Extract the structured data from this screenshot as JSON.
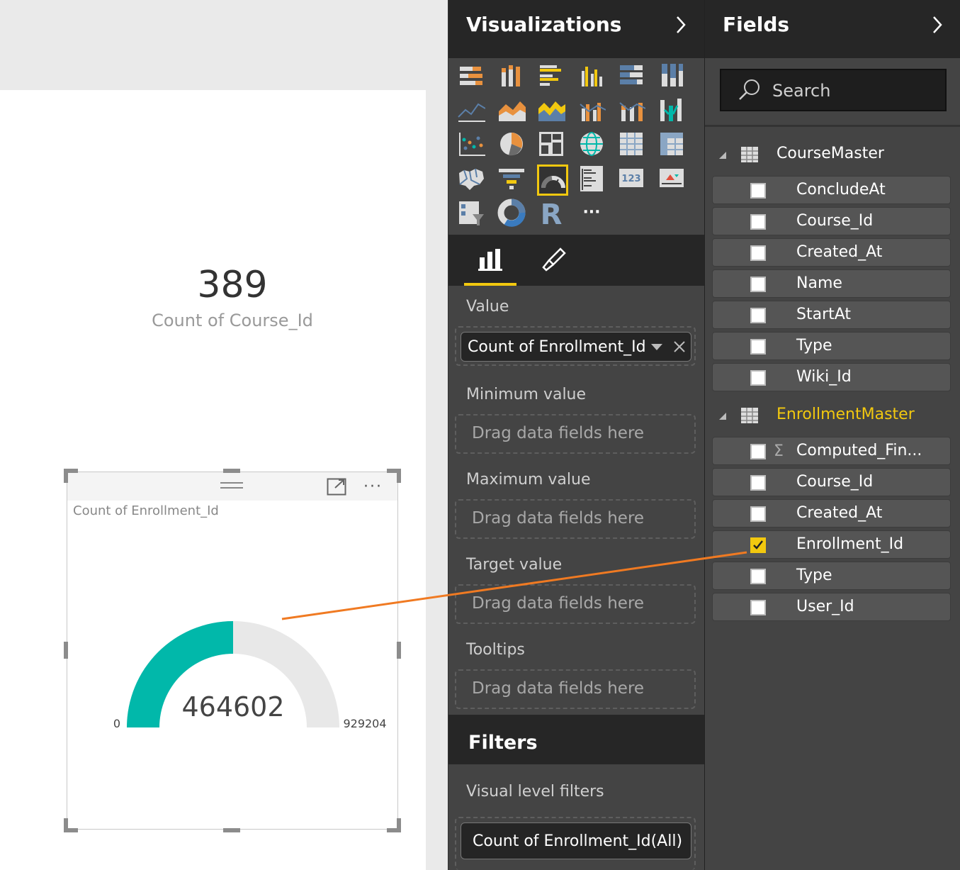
{
  "card": {
    "value": "389",
    "label": "Count of Course_Id"
  },
  "gauge": {
    "title": "Count of Enrollment_Id",
    "value": 464602,
    "value_label": "464602",
    "min_label": "0",
    "max_label": "929204",
    "fill_fraction": 0.5,
    "fill_color": "#01b8aa",
    "track_color": "#e8e8e8"
  },
  "visualizations": {
    "title": "Visualizations",
    "icons": [
      "stacked-bar-icon",
      "stacked-column-icon",
      "clustered-bar-icon",
      "clustered-column-icon",
      "100-stacked-bar-icon",
      "100-stacked-column-icon",
      "line-chart-icon",
      "area-chart-icon",
      "stacked-area-icon",
      "line-clustered-column-icon",
      "line-stacked-column-icon",
      "ribbon-chart-icon",
      "scatter-chart-icon",
      "pie-chart-icon",
      "treemap-icon",
      "globe-map-icon",
      "table-icon",
      "matrix-icon",
      "filled-map-icon",
      "funnel-icon",
      "gauge-icon",
      "multi-row-card-icon",
      "card-icon",
      "kpi-icon",
      "slicer-icon",
      "donut-chart-icon",
      "r-script-icon",
      "more-visuals-icon"
    ],
    "selected_icon": "gauge-icon",
    "r_label": "R",
    "card_label": "123",
    "more_label": "···"
  },
  "wells": {
    "value_label": "Value",
    "value_field": "Count of Enrollment_Id",
    "min_label": "Minimum value",
    "max_label": "Maximum value",
    "target_label": "Target value",
    "tooltips_label": "Tooltips",
    "drag_hint": "Drag data fields here"
  },
  "filters": {
    "title": "Filters",
    "visual_level_label": "Visual level filters",
    "filter_item": "Count of Enrollment_Id(All)"
  },
  "fields": {
    "title": "Fields",
    "search_placeholder": "Search",
    "tables": [
      {
        "name": "CourseMaster",
        "active": false,
        "fields": [
          {
            "name": "ConcludeAt",
            "checked": false
          },
          {
            "name": "Course_Id",
            "checked": false
          },
          {
            "name": "Created_At",
            "checked": false
          },
          {
            "name": "Name",
            "checked": false
          },
          {
            "name": "StartAt",
            "checked": false
          },
          {
            "name": "Type",
            "checked": false
          },
          {
            "name": "Wiki_Id",
            "checked": false
          }
        ]
      },
      {
        "name": "EnrollmentMaster",
        "active": true,
        "fields": [
          {
            "name": "Computed_Fin...",
            "checked": false,
            "sigma": true
          },
          {
            "name": "Course_Id",
            "checked": false
          },
          {
            "name": "Created_At",
            "checked": false
          },
          {
            "name": "Enrollment_Id",
            "checked": true
          },
          {
            "name": "Type",
            "checked": false
          },
          {
            "name": "User_Id",
            "checked": false
          }
        ]
      }
    ]
  },
  "colors": {
    "accent": "#f2c80f",
    "annotation_line": "#f07a22"
  }
}
